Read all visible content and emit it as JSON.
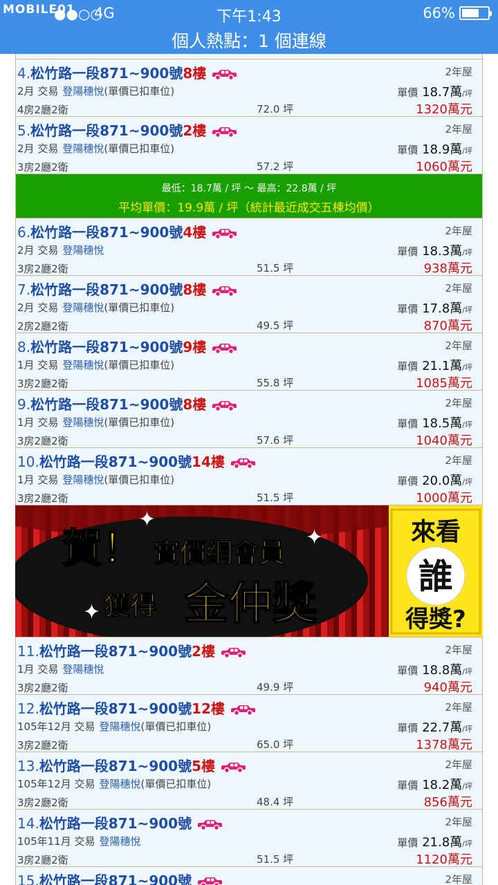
{
  "status_bar": {
    "logo": "MOBILE01",
    "carrier": "4G",
    "time": "下午1:43",
    "battery": "66%",
    "battery_level": 0.66
  },
  "header": {
    "title": "個人熱點：1 個連線"
  },
  "labels": {
    "trade_suffix": "交易",
    "unit_price_label": "單價",
    "unit_price_unit": "萬",
    "per_ping": "/坪",
    "area_unit": "坪",
    "total_unit": "萬元"
  },
  "summary": {
    "range": "最低：18.7萬 / 坪 ～ 最高：22.8萬 / 坪",
    "average": "平均單價：19.9萬 / 坪（統計最近成交五棟均價）"
  },
  "ad": {
    "line1_he": "賀！",
    "line1": "實價網會員",
    "line2a": "獲得",
    "line2b": "金仲獎",
    "side_top": "來看",
    "side_mid": "誰",
    "side_bottom": "得獎?"
  },
  "listings": [
    {
      "num": "4.",
      "addr": "松竹路一段871~900號",
      "floor": "8樓",
      "age": "2年屋",
      "date": "2月",
      "project": "登陽穗悅",
      "note": "(單價已扣車位)",
      "unit_price": "18.7",
      "rooms": "4房2廳2衛",
      "area": "72.0",
      "total": "1320"
    },
    {
      "num": "5.",
      "addr": "松竹路一段871~900號",
      "floor": "2樓",
      "age": "2年屋",
      "date": "2月",
      "project": "登陽穗悅",
      "note": "(單價已扣車位)",
      "unit_price": "18.9",
      "rooms": "3房2廳2衛",
      "area": "57.2",
      "total": "1060"
    },
    {
      "num": "6.",
      "addr": "松竹路一段871~900號",
      "floor": "4樓",
      "age": "2年屋",
      "date": "2月",
      "project": "登陽穗悅",
      "note": "",
      "unit_price": "18.3",
      "rooms": "3房2廳2衛",
      "area": "51.5",
      "total": "938"
    },
    {
      "num": "7.",
      "addr": "松竹路一段871~900號",
      "floor": "8樓",
      "age": "2年屋",
      "date": "2月",
      "project": "登陽穗悅",
      "note": "(單價已扣車位)",
      "unit_price": "17.8",
      "rooms": "2房2廳2衛",
      "area": "49.5",
      "total": "870"
    },
    {
      "num": "8.",
      "addr": "松竹路一段871~900號",
      "floor": "9樓",
      "age": "2年屋",
      "date": "1月",
      "project": "登陽穗悅",
      "note": "(單價已扣車位)",
      "unit_price": "21.1",
      "rooms": "3房2廳2衛",
      "area": "55.8",
      "total": "1085"
    },
    {
      "num": "9.",
      "addr": "松竹路一段871~900號",
      "floor": "8樓",
      "age": "2年屋",
      "date": "1月",
      "project": "登陽穗悅",
      "note": "(單價已扣車位)",
      "unit_price": "18.5",
      "rooms": "3房2廳2衛",
      "area": "57.6",
      "total": "1040"
    },
    {
      "num": "10.",
      "addr": "松竹路一段871~900號",
      "floor": "14樓",
      "age": "2年屋",
      "date": "1月",
      "project": "登陽穗悅",
      "note": "(單價已扣車位)",
      "unit_price": "20.0",
      "rooms": "3房2廳2衛",
      "area": "51.5",
      "total": "1000"
    },
    {
      "num": "11.",
      "addr": "松竹路一段871~900號",
      "floor": "2樓",
      "age": "2年屋",
      "date": "1月",
      "project": "登陽穗悅",
      "note": "",
      "unit_price": "18.8",
      "rooms": "3房2廳2衛",
      "area": "49.9",
      "total": "940"
    },
    {
      "num": "12.",
      "addr": "松竹路一段871~900號",
      "floor": "12樓",
      "age": "2年屋",
      "date": "105年12月",
      "project": "登陽穗悅",
      "note": "(單價已扣車位)",
      "unit_price": "22.7",
      "rooms": "3房2廳2衛",
      "area": "65.0",
      "total": "1378"
    },
    {
      "num": "13.",
      "addr": "松竹路一段871~900號",
      "floor": "5樓",
      "age": "2年屋",
      "date": "105年12月",
      "project": "登陽穗悅",
      "note": "(單價已扣車位)",
      "unit_price": "18.2",
      "rooms": "3房2廳2衛",
      "area": "48.4",
      "total": "856"
    },
    {
      "num": "14.",
      "addr": "松竹路一段871~900號",
      "floor": "",
      "age": "2年屋",
      "date": "105年11月",
      "project": "登陽穗悅",
      "note": "",
      "unit_price": "21.8",
      "rooms": "3房2廳2衛",
      "area": "51.5",
      "total": "1120"
    },
    {
      "num": "15.",
      "addr": "松竹路一段871~900號",
      "floor": "",
      "age": "2年屋",
      "date": "",
      "project": "",
      "note": "",
      "unit_price": "",
      "rooms": "",
      "area": "",
      "total": ""
    }
  ]
}
